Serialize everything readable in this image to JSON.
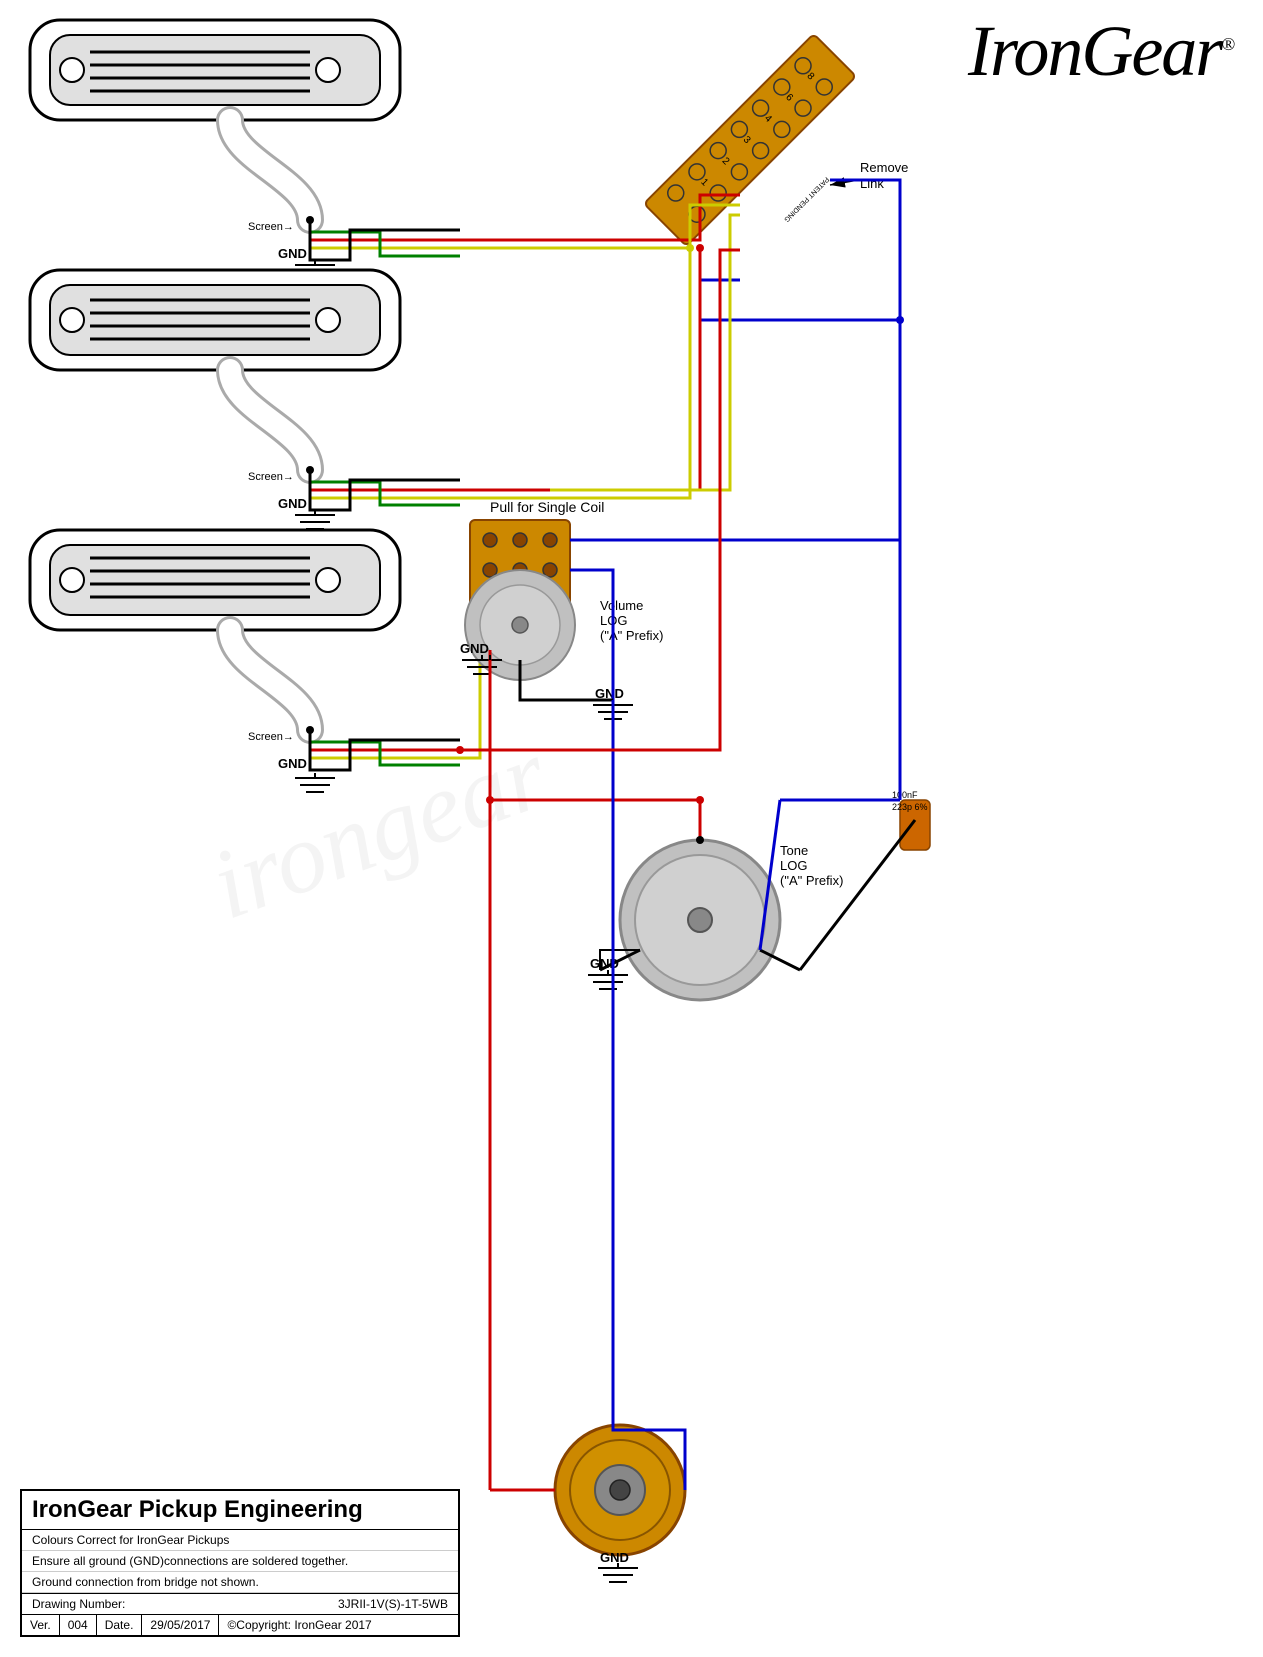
{
  "logo": {
    "text": "IronGear",
    "trademark": "®"
  },
  "title": "IronGear Pickup Engineering",
  "footer": {
    "title": "IronGear Pickup Engineering",
    "line1": "Colours Correct for IronGear Pickups",
    "line2": "Ensure all ground (GND)connections are soldered together.",
    "line3": "Ground connection from bridge not shown.",
    "drawing_label": "Drawing Number:",
    "drawing_number": "3JRII-1V(S)-1T-5WB",
    "ver_label": "Ver.",
    "ver_value": "004",
    "date_label": "Date.",
    "date_value": "29/05/2017",
    "copyright": "©Copyright: IronGear 2017"
  },
  "labels": {
    "screen": "Screen→",
    "gnd": "GND",
    "pull_single_coil": "Pull for Single Coil",
    "volume_log": "Volume",
    "volume_a": "LOG",
    "volume_prefix": "(\"A\" Prefix)",
    "tone_log": "Tone",
    "tone_a": "LOG",
    "tone_prefix": "(\"A\" Prefix)",
    "remove_link": "Remove\nLink"
  },
  "colors": {
    "red": "#cc0000",
    "yellow": "#cccc00",
    "blue": "#0000cc",
    "green": "#008000",
    "black": "#000000",
    "gray": "#888888",
    "white": "#ffffff",
    "orange": "#cc6600"
  },
  "watermark": "irongear"
}
